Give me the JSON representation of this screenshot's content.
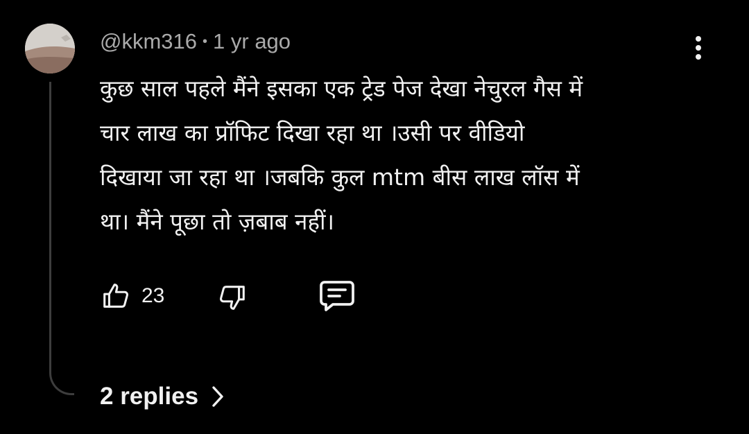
{
  "comment": {
    "author": "@kkm316",
    "separator": "•",
    "age": "1 yr ago",
    "text_lines": [
      "कुछ साल पहले मैंने इसका एक ट्रेड पेज देखा नेचुरल गैस में",
      "चार लाख का प्रॉफिट दिखा रहा था ।उसी पर वीडियो",
      "दिखाया जा रहा था ।जबकि कुल mtm बीस लाख लॉस में",
      "था। मैंने पूछा तो ज़बाब नहीं।"
    ],
    "likes": "23",
    "replies_label": "2 replies"
  },
  "icons": {
    "like": "thumbs-up-icon",
    "dislike": "thumbs-down-icon",
    "reply": "comment-reply-icon",
    "menu": "more-vertical-icon",
    "expand": "chevron-right-icon"
  },
  "colors": {
    "background": "#000000",
    "text": "#f1f1f1",
    "meta_text": "#aaaaaa",
    "thread_line": "#3d3d3d"
  }
}
